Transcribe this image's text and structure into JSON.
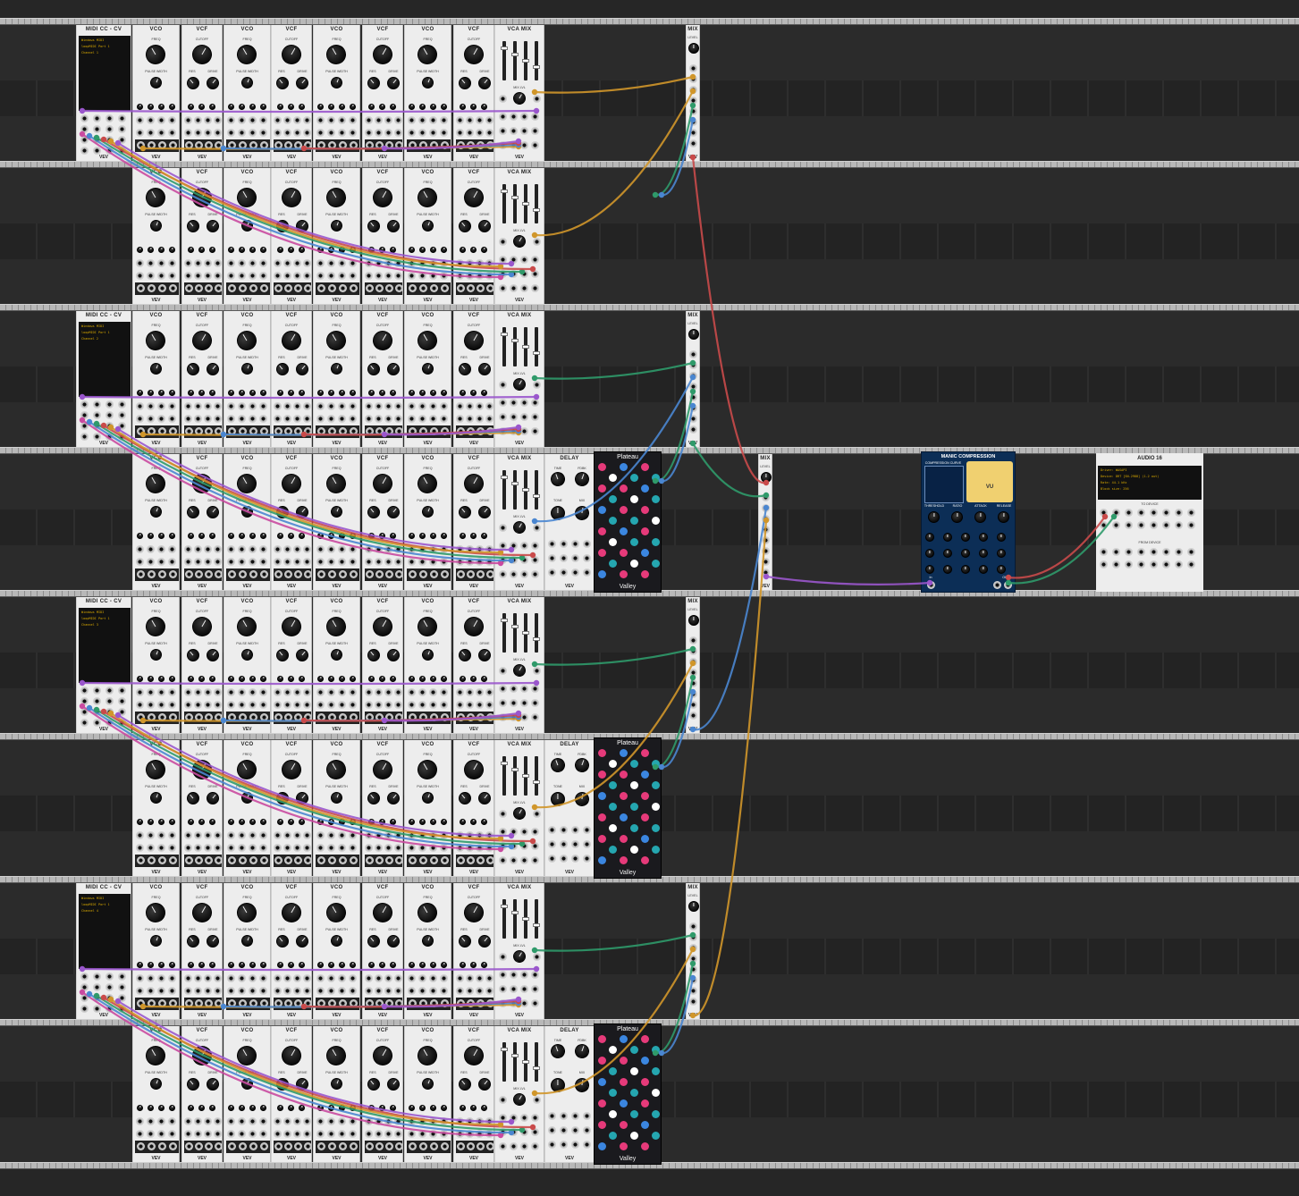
{
  "labels": {
    "midi_title": "MIDI CC - CV",
    "vco": "VCO",
    "vcf": "VCF",
    "vca": "VCA MIX",
    "mix": "MIX",
    "delay": "DELAY",
    "plateau": "Plateau",
    "valley": "Valley",
    "comp_title": "MANIC COMPRESSION",
    "audio_title": "AUDIO 16",
    "brand": "VEV",
    "freq": "FREQ",
    "cutoff": "CUTOFF",
    "pulse_width": "PULSE WIDTH",
    "res": "RES",
    "drive": "DRIVE",
    "level": "LEVEL",
    "mix_lvl": "MIX LVL",
    "time": "TIME",
    "fdbk": "FDBK",
    "tone": "TONE",
    "mix_knob": "MIX",
    "to_device": "TO DEVICE",
    "from_device": "FROM DEVICE",
    "comp_curve": "COMPRESSION CURVE",
    "vu": "VU",
    "threshold": "THRESHOLD",
    "ratio": "RATIO",
    "attack": "ATTACK",
    "release": "RELEASE",
    "input": "In",
    "output": "OUT",
    "lout_rout": "L Out R Out"
  },
  "midi_screens": [
    {
      "driver": "Windows MIDI",
      "device": "loopMIDI Port 1",
      "channel": "Channel 1"
    },
    {
      "driver": "Windows MIDI",
      "device": "loopMIDI Port 1",
      "channel": "Channel 2"
    },
    {
      "driver": "Windows MIDI",
      "device": "loopMIDI Port 1",
      "channel": "Channel 3"
    },
    {
      "driver": "Windows MIDI",
      "device": "loopMIDI Port 1",
      "channel": "Channel 4"
    }
  ],
  "audio": {
    "driver": "Driver: WASAPI",
    "device": "Device: DRT [SN-2988] (1-2 out)",
    "rate": "Rate: 44.1 kHz",
    "block": "Block size: 256"
  },
  "colors": {
    "red": "#c94a4a",
    "green": "#2f9a6a",
    "blue": "#4a86d0",
    "orange": "#d0962a",
    "purple": "#9a56cc",
    "pink": "#c94aa0",
    "teal": "#2fa8a8"
  }
}
